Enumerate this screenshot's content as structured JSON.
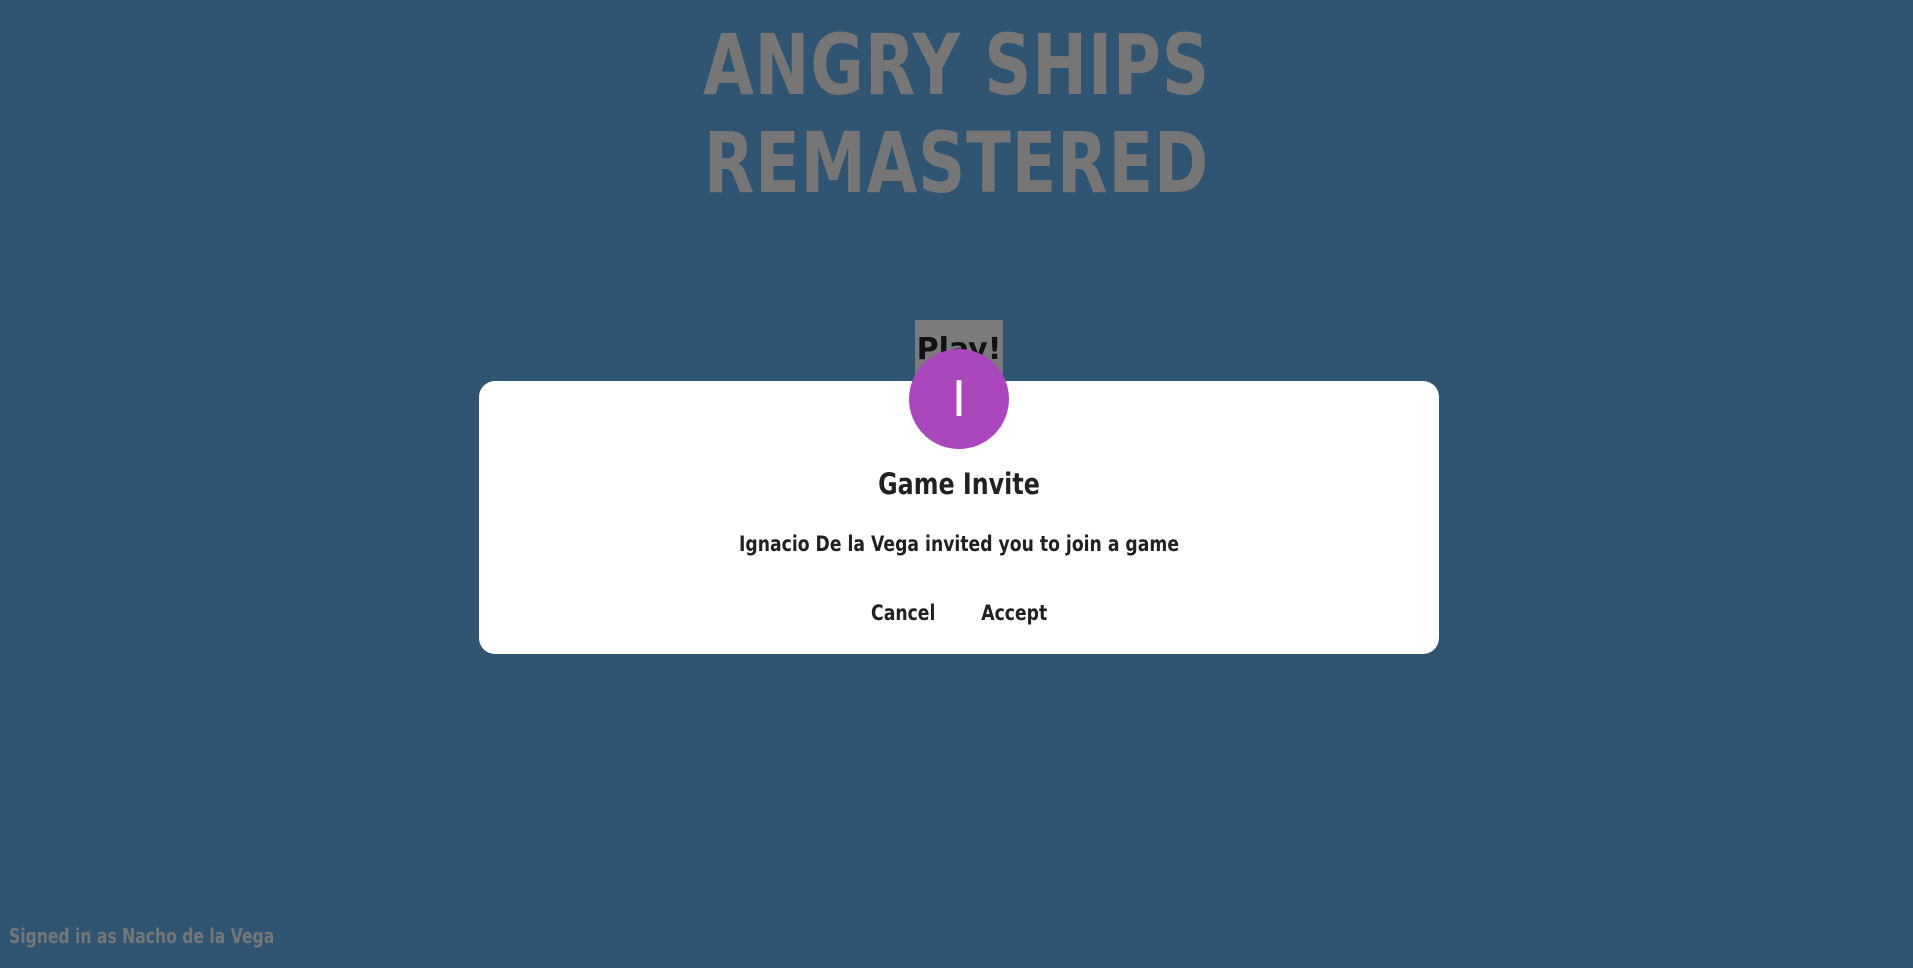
{
  "app": {
    "title_line1": "ANGRY SHIPS",
    "title_line2": "REMASTERED",
    "play_label": "Play!"
  },
  "dialog": {
    "avatar_initial": "I",
    "avatar_color": "#ab47bc",
    "title": "Game Invite",
    "message": "Ignacio De la Vega invited you to join a game",
    "cancel_label": "Cancel",
    "accept_label": "Accept"
  },
  "footer": {
    "signed_in_text": "Signed in as Nacho de la Vega"
  },
  "colors": {
    "background": "#2f5572",
    "title_gray": "#767676",
    "dialog_bg": "#ffffff",
    "text_dark": "#212121"
  }
}
